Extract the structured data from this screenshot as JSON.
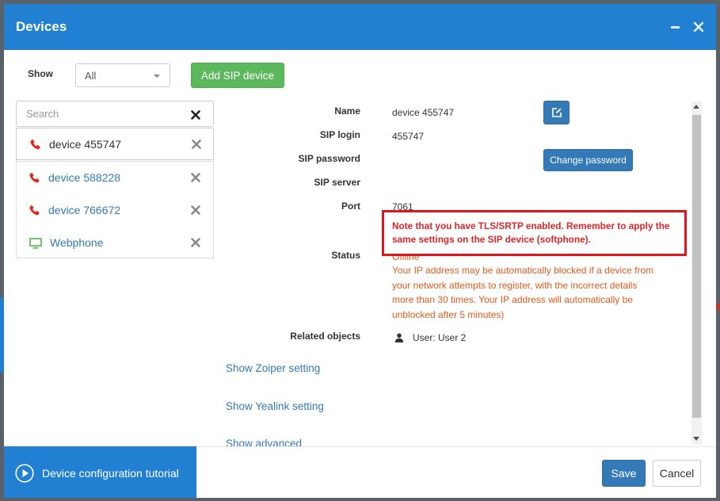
{
  "window": {
    "title": "Devices",
    "minimize_icon": "minimize-icon",
    "close_icon": "close-icon"
  },
  "filter": {
    "show_label": "Show",
    "show_value": "All",
    "add_button": "Add SIP device"
  },
  "search": {
    "placeholder": "Search",
    "clear_icon": "clear-icon"
  },
  "devices": [
    {
      "name": "device 455747",
      "icon": "phone-icon",
      "selected": true
    },
    {
      "name": "device 588228",
      "icon": "phone-icon",
      "selected": false
    },
    {
      "name": "device 766672",
      "icon": "phone-icon",
      "selected": false
    },
    {
      "name": "Webphone",
      "icon": "monitor-icon",
      "selected": false
    }
  ],
  "details": {
    "name_label": "Name",
    "name_value": "device 455747",
    "edit_icon": "edit-icon",
    "sip_login_label": "SIP login",
    "sip_login_value": "455747",
    "sip_password_label": "SIP password",
    "change_password": "Change password",
    "sip_server_label": "SIP server",
    "port_label": "Port",
    "port_value": "7061",
    "note_lines": [
      "Note that you have TLS/SRTP enabled. Remember to apply the",
      "same settings on the SIP device (softphone)."
    ],
    "status_label": "Status",
    "status_value": "Offline",
    "status_warning_lines": [
      "Your IP address may be automatically blocked if a device from",
      "your network attempts to register, with the incorrect details",
      "more than 30 times. Your IP address will automatically be",
      "unblocked after 5 minutes)"
    ],
    "related_label": "Related objects",
    "related_value": "User: User 2",
    "related_icon": "user-icon",
    "links": {
      "zoiper": "Show Zoiper setting",
      "yealink": "Show Yealink setting",
      "advanced": "Show advanced"
    }
  },
  "footer": {
    "tutorial": "Device configuration tutorial",
    "tutorial_icon": "play-circle-icon",
    "save": "Save",
    "cancel": "Cancel"
  },
  "colors": {
    "header": "#2180d1",
    "primary": "#337ab7",
    "success": "#5cb85c",
    "note": "#e0262a",
    "warn": "#e35a1c",
    "highlight": "#e0141b",
    "phone": "#e5231b",
    "monitor": "#5cb85c",
    "link": "#337ab7"
  }
}
